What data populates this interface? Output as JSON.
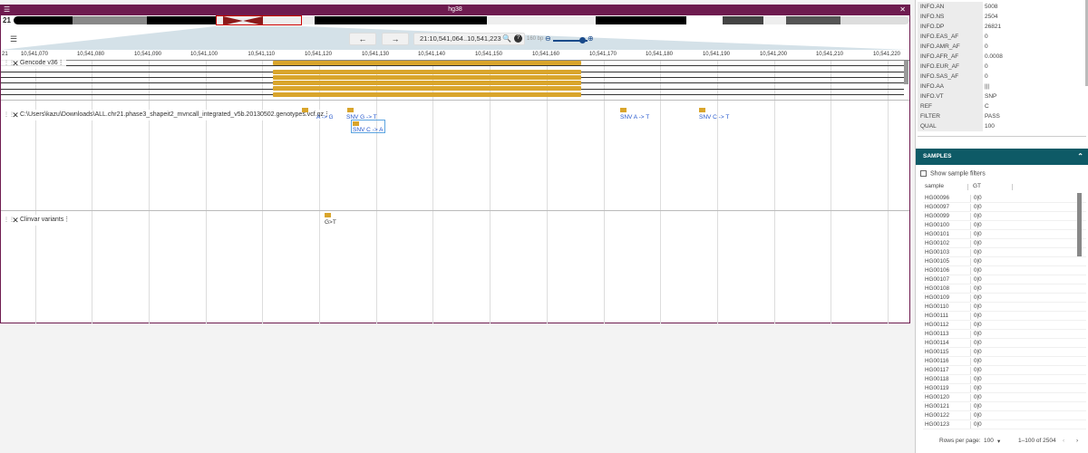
{
  "window": {
    "title": "hg38",
    "menu_icon": "menu-icon",
    "close_icon": "close-icon"
  },
  "ideogram": {
    "chrom": "21"
  },
  "nav": {
    "back": "←",
    "forward": "→",
    "locus": "21:10,541,064..10,541,223",
    "zoom_label": "160 bp",
    "zoom_minus": "⊖",
    "zoom_plus": "⊕"
  },
  "ruler": {
    "start_label": "21",
    "ticks": [
      "10,541,070",
      "10,541,080",
      "10,541,090",
      "10,541,100",
      "10,541,110",
      "10,541,120",
      "10,541,130",
      "10,541,140",
      "10,541,150",
      "10,541,160",
      "10,541,170",
      "10,541,180",
      "10,541,190",
      "10,541,200",
      "10,541,210",
      "10,541,220"
    ]
  },
  "tracks": {
    "gencode": {
      "name": "Gencode v36"
    },
    "vcf": {
      "name": "C:\\Users\\kazu\\Downloads\\ALL.chr21.phase3_shapeit2_mvncall_integrated_v5b.20130502.genotypes.vcf.gz",
      "labels": [
        "A -> G",
        "SNV G -> T",
        "SNV C -> A",
        "SNV A -> T",
        "SNV C -> T"
      ]
    },
    "clinvar": {
      "name": "Clinvar variants",
      "labels": [
        "G>T"
      ]
    }
  },
  "info": [
    {
      "k": "INFO.AN",
      "v": "5008"
    },
    {
      "k": "INFO.NS",
      "v": "2504"
    },
    {
      "k": "INFO.DP",
      "v": "26821"
    },
    {
      "k": "INFO.EAS_AF",
      "v": "0"
    },
    {
      "k": "INFO.AMR_AF",
      "v": "0"
    },
    {
      "k": "INFO.AFR_AF",
      "v": "0.0008"
    },
    {
      "k": "INFO.EUR_AF",
      "v": "0"
    },
    {
      "k": "INFO.SAS_AF",
      "v": "0"
    },
    {
      "k": "INFO.AA",
      "v": "|||"
    },
    {
      "k": "INFO.VT",
      "v": "SNP"
    },
    {
      "k": "REF",
      "v": "C"
    },
    {
      "k": "FILTER",
      "v": "PASS"
    },
    {
      "k": "QUAL",
      "v": "100"
    }
  ],
  "samples": {
    "header": "SAMPLES",
    "filter_label": "Show sample filters",
    "col_sample": "sample",
    "col_gt": "GT",
    "rows": [
      {
        "s": "HG00096",
        "g": "0|0"
      },
      {
        "s": "HG00097",
        "g": "0|0"
      },
      {
        "s": "HG00099",
        "g": "0|0"
      },
      {
        "s": "HG00100",
        "g": "0|0"
      },
      {
        "s": "HG00101",
        "g": "0|0"
      },
      {
        "s": "HG00102",
        "g": "0|0"
      },
      {
        "s": "HG00103",
        "g": "0|0"
      },
      {
        "s": "HG00105",
        "g": "0|0"
      },
      {
        "s": "HG00106",
        "g": "0|0"
      },
      {
        "s": "HG00107",
        "g": "0|0"
      },
      {
        "s": "HG00108",
        "g": "0|0"
      },
      {
        "s": "HG00109",
        "g": "0|0"
      },
      {
        "s": "HG00110",
        "g": "0|0"
      },
      {
        "s": "HG00111",
        "g": "0|0"
      },
      {
        "s": "HG00112",
        "g": "0|0"
      },
      {
        "s": "HG00113",
        "g": "0|0"
      },
      {
        "s": "HG00114",
        "g": "0|0"
      },
      {
        "s": "HG00115",
        "g": "0|0"
      },
      {
        "s": "HG00116",
        "g": "0|0"
      },
      {
        "s": "HG00117",
        "g": "0|0"
      },
      {
        "s": "HG00118",
        "g": "0|0"
      },
      {
        "s": "HG00119",
        "g": "0|0"
      },
      {
        "s": "HG00120",
        "g": "0|0"
      },
      {
        "s": "HG00121",
        "g": "0|0"
      },
      {
        "s": "HG00122",
        "g": "0|0"
      },
      {
        "s": "HG00123",
        "g": "0|0"
      }
    ],
    "rows_per_page_label": "Rows per page:",
    "rows_per_page": "100",
    "range": "1–100 of 2504"
  }
}
